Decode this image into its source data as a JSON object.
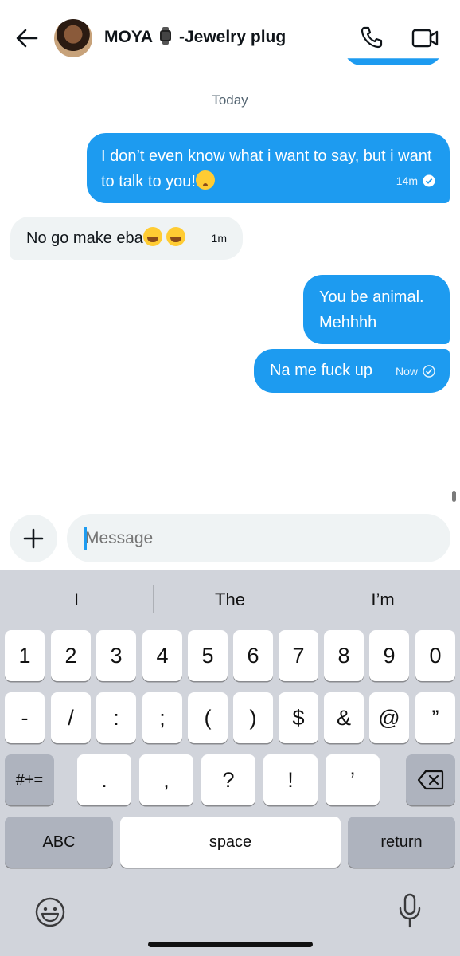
{
  "header": {
    "contact_name_prefix": "MOYA",
    "contact_name_suffix": "-Jewelry plug",
    "icons": [
      "back-arrow-icon",
      "avatar",
      "watch-emoji",
      "phone-icon",
      "video-camera-icon"
    ]
  },
  "conversation": {
    "date_divider": "Today",
    "messages": [
      {
        "direction": "outgoing",
        "text": "I don’t even know what i want to say, but i want to talk to you!",
        "emoji": "pleading-face",
        "time": "14m",
        "status": "read"
      },
      {
        "direction": "incoming",
        "text": "No go make eba",
        "emoji": "tears-of-joy x2",
        "time": "1m"
      },
      {
        "direction": "outgoing",
        "text": "You be animal. Mehhhh"
      },
      {
        "direction": "outgoing",
        "text": "Na me fuck up",
        "time": "Now",
        "status": "sent"
      }
    ]
  },
  "composer": {
    "placeholder": "Message"
  },
  "keyboard": {
    "suggestions": [
      "I",
      "The",
      "I’m"
    ],
    "row1": [
      "1",
      "2",
      "3",
      "4",
      "5",
      "6",
      "7",
      "8",
      "9",
      "0"
    ],
    "row2": [
      "-",
      "/",
      ":",
      ";",
      "(",
      ")",
      "$",
      "&",
      "@",
      "”"
    ],
    "row3": {
      "shift": "#+=",
      "keys": [
        ".",
        ",",
        "?",
        "!",
        "’"
      ]
    },
    "row4": {
      "mode": "ABC",
      "space": "space",
      "return": "return"
    }
  },
  "colors": {
    "accent": "#1d9bf0",
    "incoming_bubble": "#eff3f4",
    "keyboard_bg": "#d1d4db"
  }
}
